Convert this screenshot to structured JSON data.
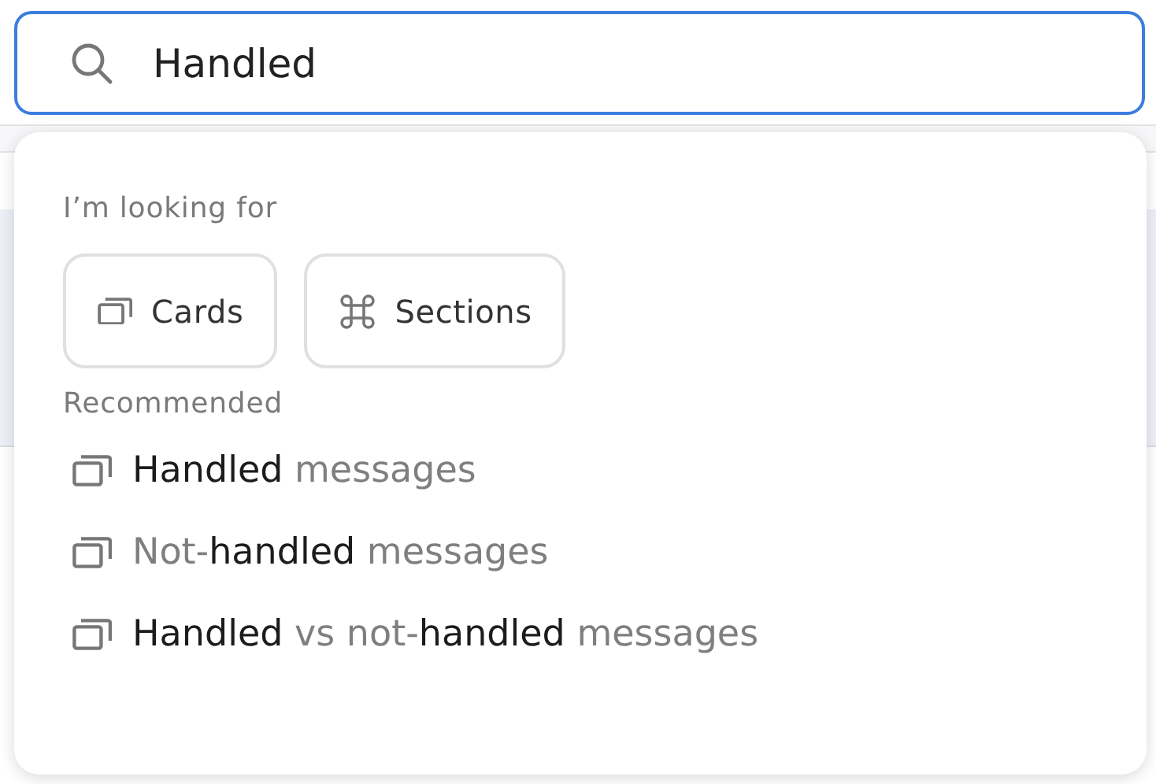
{
  "search": {
    "value": "Handled"
  },
  "dropdown": {
    "looking_for_label": "I’m looking for",
    "filters": [
      {
        "kind": "cards",
        "label": "Cards"
      },
      {
        "kind": "sections",
        "label": "Sections"
      }
    ],
    "recommended_label": "Recommended",
    "results": [
      {
        "kind": "cards",
        "text": "**Handled** messages"
      },
      {
        "kind": "cards",
        "text": "Not-**handled** messages"
      },
      {
        "kind": "cards",
        "text": "**Handled** vs not-**handled** messages"
      }
    ]
  }
}
